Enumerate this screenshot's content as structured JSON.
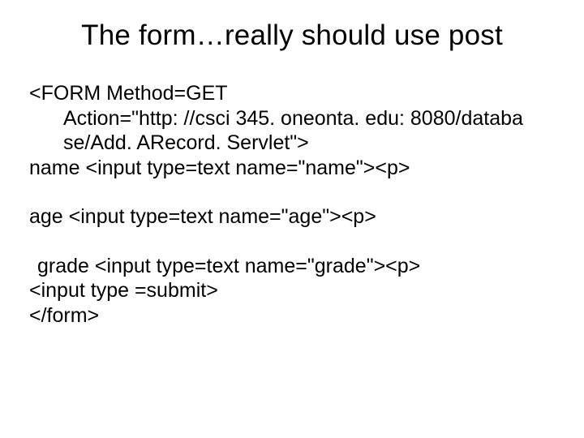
{
  "title": "The form…really should use post",
  "lines": {
    "l1": "<FORM Method=GET",
    "l2": "Action=\"http: //csci 345. oneonta. edu: 8080/databa",
    "l3": "se/Add. ARecord. Servlet\">",
    "l4": "name <input type=text name=\"name\"><p>",
    "l5": "age <input type=text name=\"age\"><p>",
    "l6": "grade <input type=text name=\"grade\"><p>",
    "l7": "<input type =submit>",
    "l8": "</form>"
  }
}
